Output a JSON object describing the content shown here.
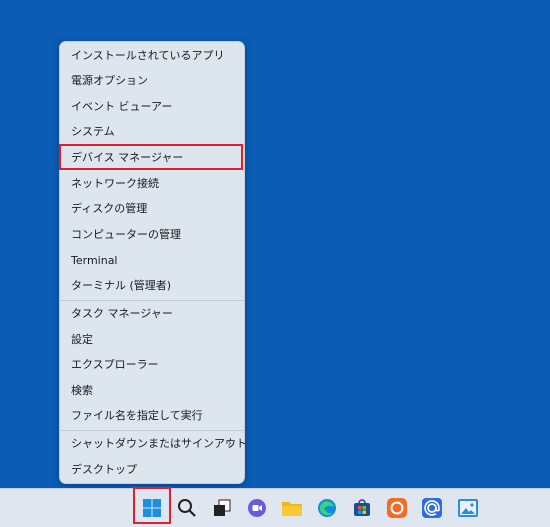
{
  "menu": {
    "items": [
      {
        "label": "インストールされているアプリ"
      },
      {
        "label": "電源オプション"
      },
      {
        "label": "イベント ビューアー"
      },
      {
        "label": "システム"
      },
      {
        "label": "デバイス マネージャー"
      },
      {
        "label": "ネットワーク接続"
      },
      {
        "label": "ディスクの管理"
      },
      {
        "label": "コンピューターの管理"
      },
      {
        "label": "Terminal"
      },
      {
        "label": "ターミナル (管理者)"
      },
      {
        "label": "タスク マネージャー"
      },
      {
        "label": "設定"
      },
      {
        "label": "エクスプローラー"
      },
      {
        "label": "検索"
      },
      {
        "label": "ファイル名を指定して実行"
      },
      {
        "label": "シャットダウンまたはサインアウト",
        "chevron": "›"
      },
      {
        "label": "デスクトップ"
      }
    ]
  },
  "taskbar": {
    "icons": [
      "windows-start-icon",
      "search-icon",
      "task-view-icon",
      "chat-icon",
      "file-explorer-icon",
      "edge-icon",
      "store-icon",
      "avast-icon",
      "mail-icon",
      "photos-icon"
    ]
  },
  "colors": {
    "desktop": "#0a5cb4",
    "highlight": "#e0202c",
    "menu_bg": "#dde5ef"
  }
}
